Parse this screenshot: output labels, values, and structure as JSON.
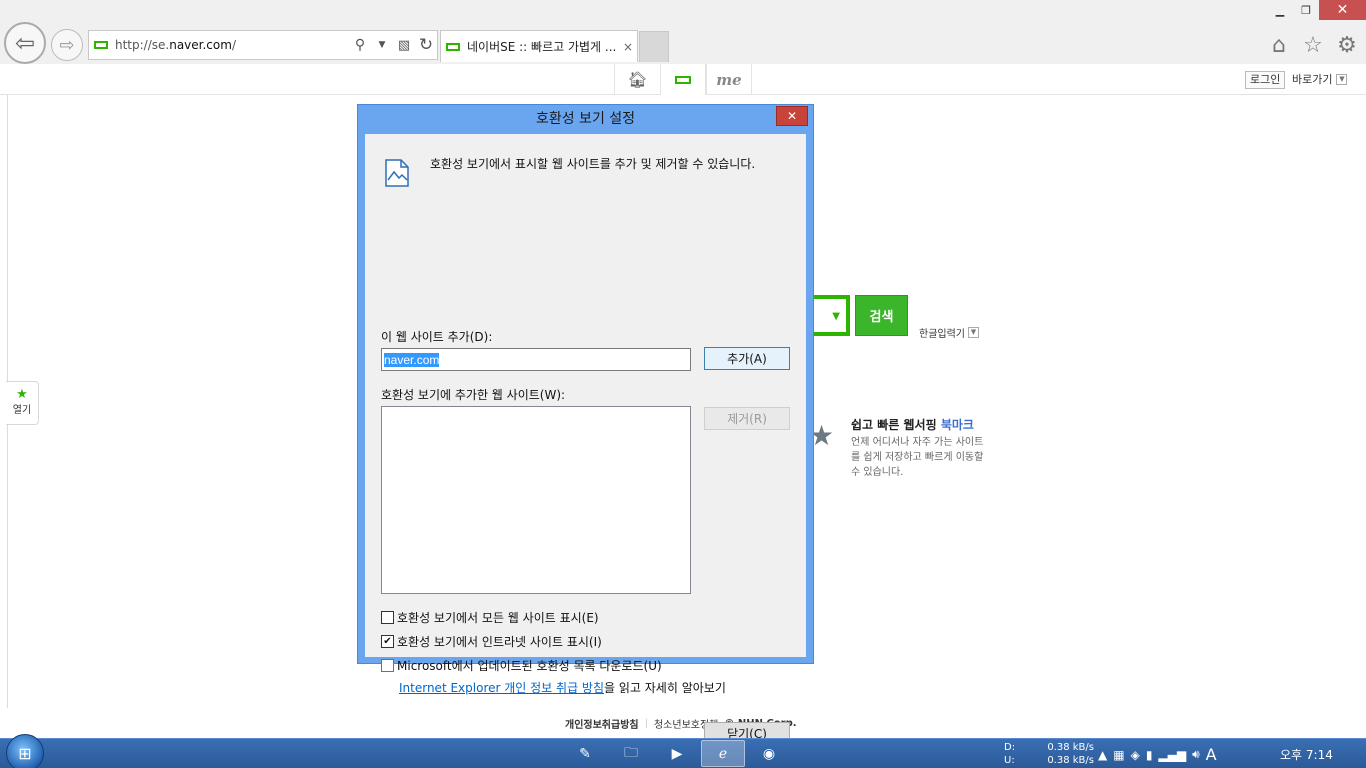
{
  "window": {
    "minimize_icon": "minimize-icon",
    "restore_icon": "restore-icon",
    "close_icon": "close-icon"
  },
  "browser": {
    "address_url_prefix": "http://se.",
    "address_url_host": "naver.com",
    "address_url_suffix": "/",
    "tab_title": "네이버SE :: 빠르고 가볍게 ...",
    "tab_close": "×"
  },
  "se_toolbar": {
    "me_label": "me",
    "login_label": "로그인",
    "goto_label": "바로가기"
  },
  "page": {
    "open_label": "열기",
    "search_button": "검색",
    "hangul_input": "한글입력기",
    "promo_title_main": "쉽고 빠른 웹서핑 ",
    "promo_title_highlight": "북마크",
    "promo_desc": "언제 어디서나 자주 가는 사이트를 쉽게 저장하고 빠르게 이동할 수 있습니다.",
    "footer": {
      "privacy": "개인정보취급방침",
      "youth": "청소년보호정책",
      "copyright": "© NHN Corp."
    }
  },
  "dialog": {
    "title": "호환성 보기 설정",
    "close_glyph": "✕",
    "intro": "호환성 보기에서 표시할 웹 사이트를 추가 및 제거할 수 있습니다.",
    "add_site_label": "이 웹 사이트 추가(D):",
    "add_site_value": "naver.com",
    "add_button": "추가(A)",
    "list_label": "호환성 보기에 추가한 웹 사이트(W):",
    "remove_button": "제거(R)",
    "options": [
      {
        "label": "호환성 보기에서 모든 웹 사이트 표시(E)",
        "checked": false
      },
      {
        "label": "호환성 보기에서 인트라넷 사이트 표시(I)",
        "checked": true
      },
      {
        "label": "Microsoft에서 업데이트된 호환성 목록 다운로드(U)",
        "checked": false
      }
    ],
    "link_text": "Internet Explorer 개인 정보 취급 방침",
    "link_suffix": "을 읽고 자세히 알아보기",
    "close_button": "닫기(C)"
  },
  "taskbar": {
    "net_down_label": "D:",
    "net_down_value": "0.38 kB/s",
    "net_up_label": "U:",
    "net_up_value": "0.38 kB/s",
    "ime_label": "A",
    "clock": "오후 7:14"
  },
  "colors": {
    "naver_green": "#2db400",
    "dialog_frame": "#6aa5ef",
    "close_red": "#c7443a",
    "taskbar": "#2b5a98"
  }
}
